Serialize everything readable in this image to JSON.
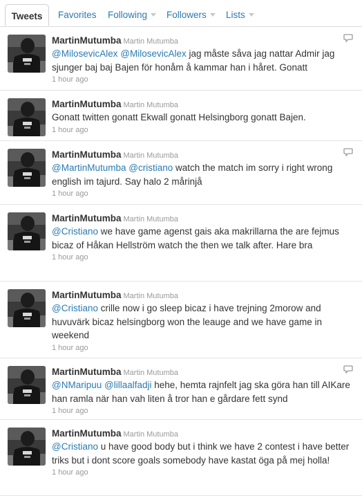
{
  "tabs": {
    "tweets": "Tweets",
    "favorites": "Favorites",
    "following": "Following",
    "followers": "Followers",
    "lists": "Lists"
  },
  "tweets": [
    {
      "screen_name": "MartinMutumba",
      "full_name": "Martin Mutumba",
      "has_reply_icon": true,
      "segments": [
        {
          "t": "@MilosevicAlex",
          "m": true
        },
        {
          "t": " ",
          "m": false
        },
        {
          "t": "@MilosevicAlex",
          "m": true
        },
        {
          "t": " jag måste såva jag nattar Admir jag sjunger baj baj Bajen för honåm å kammar han i håret. Gonatt",
          "m": false
        }
      ],
      "time": "1 hour ago"
    },
    {
      "screen_name": "MartinMutumba",
      "full_name": "Martin Mutumba",
      "has_reply_icon": false,
      "segments": [
        {
          "t": "Gonatt twitten gonatt Ekwall gonatt Helsingborg gonatt Bajen.",
          "m": false
        }
      ],
      "time": "1 hour ago"
    },
    {
      "screen_name": "MartinMutumba",
      "full_name": "Martin Mutumba",
      "has_reply_icon": true,
      "segments": [
        {
          "t": "@MartinMutumba",
          "m": true
        },
        {
          "t": " ",
          "m": false
        },
        {
          "t": "@cristiano",
          "m": true
        },
        {
          "t": " watch the match im sorry i right wrong english im tajurd. Say halo 2 mårinjå",
          "m": false
        }
      ],
      "time": "1 hour ago"
    },
    {
      "screen_name": "MartinMutumba",
      "full_name": "Martin Mutumba",
      "has_reply_icon": false,
      "segments": [
        {
          "t": "@Cristiano",
          "m": true
        },
        {
          "t": " we have game agenst gais aka makrillarna the are fejmus bicaz of Håkan Hellström watch the then we talk after. Hare bra",
          "m": false
        }
      ],
      "time": "1 hour ago"
    },
    {
      "screen_name": "MartinMutumba",
      "full_name": "Martin Mutumba",
      "has_reply_icon": false,
      "segments": [
        {
          "t": "@Cristiano",
          "m": true
        },
        {
          "t": " crille now i go sleep bicaz i have trejning 2morow and huvuvärk bicaz helsingborg won the leauge and we have game in weekend",
          "m": false
        }
      ],
      "time": "1 hour ago"
    },
    {
      "screen_name": "MartinMutumba",
      "full_name": "Martin Mutumba",
      "has_reply_icon": true,
      "segments": [
        {
          "t": "@NMaripuu",
          "m": true
        },
        {
          "t": " ",
          "m": false
        },
        {
          "t": "@lillaalfadji",
          "m": true
        },
        {
          "t": " hehe, hemta rajnfelt jag ska göra han till AIKare han ramla när han vah liten å tror han e gårdare fett synd",
          "m": false
        }
      ],
      "time": "1 hour ago"
    },
    {
      "screen_name": "MartinMutumba",
      "full_name": "Martin Mutumba",
      "has_reply_icon": false,
      "segments": [
        {
          "t": "@Cristiano",
          "m": true
        },
        {
          "t": " u have good body but i think we have 2 contest i have better triks but i dont score goals somebody have kastat öga på mej holla!",
          "m": false
        }
      ],
      "time": "1 hour ago"
    }
  ],
  "colors": {
    "link": "#2a7ab0",
    "text": "#333333",
    "meta": "#999999",
    "divider": "#e3e3e3"
  }
}
